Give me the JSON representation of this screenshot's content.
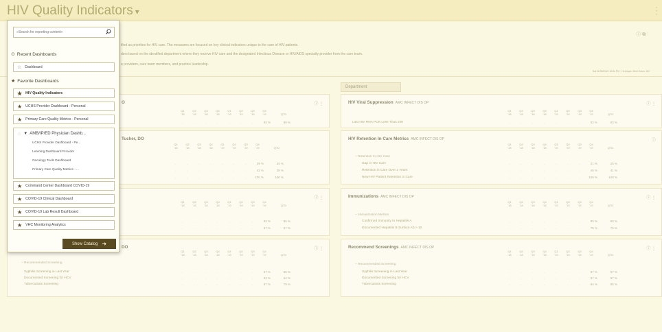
{
  "header": {
    "title": "HIV Quality Indicators",
    "caret": "▾",
    "menu_icon": "kebab-menu-icon"
  },
  "description": {
    "line1": "ified as priorities for HIV care. The measures are focused on key clinical indicators unique to the care of HIV patients.",
    "line2": "ders based on the identified department where they receive HIV care and the designated Infectious Disease or HIV/AIDS specialty provider from the care team.",
    "line3": "e providers, care team members, and practice leadership.",
    "timestamp": "Sat 11/30/2019 10:53 PM · Henrique, Bem Tozzo, DO",
    "icons": "ⓘ ⧉ ⋮"
  },
  "department_tab": "Department",
  "dropdown": {
    "search_placeholder": "»Search for reporting content«",
    "recent_header": "Recent Dashboards",
    "recent_items": [
      "Dashboard"
    ],
    "favorite_header": "Favorite Dashboards",
    "favorites_top": [
      "HIV Quality Indicators",
      "UCHS Provider Dashboard - Personal",
      "Primary Care Quality Metrics - Personal"
    ],
    "group": {
      "label": "AMB/IP/ED Physician Dashb...",
      "items": [
        "UCHS Provider Dashboard - Pe...",
        "Learning Dashboard Provider",
        "Oncology Tools Dashboard",
        "Primary Care Quality Metrics - ..."
      ]
    },
    "favorites_bottom": [
      "Command Center Dashboard COVID-19",
      "COVID-19 Clinical Dashboard",
      "COVID-19 Lab Result Dashboard",
      "VHC Monitoring Analytics"
    ],
    "show_catalog": "Show Catalog"
  },
  "left_cards": {
    "c1_title_frag": "O",
    "c2_title_frag": "Tucker, DO",
    "c4_title_frag": "DO",
    "c1_vals": [
      "93 %",
      "88 %"
    ],
    "c2_vals": [
      [
        "29 %",
        "26 %"
      ],
      [
        "42 %",
        "39 %"
      ],
      [
        "100 %",
        "100 %"
      ]
    ],
    "c3_vals": [
      [
        "93 %",
        "85 %"
      ],
      [
        "67 %",
        "67 %"
      ]
    ],
    "c4": {
      "group": "− Recommended Screening",
      "rows": [
        {
          "label": "Syphilis Screening in Last Year",
          "v1": "57 %",
          "v2": "65 %"
        },
        {
          "label": "Documented Screening for HCV",
          "v1": "93 %",
          "v2": "94 %"
        },
        {
          "label": "Tuberculosis Screening",
          "v1": "67 %",
          "v2": "79 %"
        }
      ]
    }
  },
  "quarter_cols": [
    "Q1 '18",
    "Q2 '18",
    "Q3 '18",
    "Q4 '18",
    "Q1 '19",
    "Q2 '19",
    "Q3 '19",
    "Q4 '19"
  ],
  "ytd": "QTD",
  "dept_cards": {
    "viral": {
      "title": "HIV Viral Suppression",
      "dept": "AMC INFECT DIS OP",
      "rows": [
        {
          "label": "Last HIV RNA PCR Less Than 200",
          "v1": "92 %",
          "v2": "93 %"
        }
      ]
    },
    "retention": {
      "title": "HIV Retention In Care Metrics",
      "dept": "AMC INFECT DIS OP",
      "group": "− Retention In HIV Care",
      "q4": "Q4 '19",
      "rows": [
        {
          "label": "Gap in HIV Care",
          "v1": "21 %",
          "v2": "25 %"
        },
        {
          "label": "Retention in Care Over 2 Years",
          "v1": "46 %",
          "v2": "41 %"
        },
        {
          "label": "New HIV Patient Retention in Care",
          "v1": "100 %",
          "v2": "100 %"
        }
      ]
    },
    "immun": {
      "title": "Immunizations",
      "dept": "AMC INFECT DIS OP",
      "group": "− Immunization Metrics",
      "rows": [
        {
          "label": "Confirmed Immunity to Hepatitis A",
          "v1": "80 %",
          "v2": "80 %"
        },
        {
          "label": "Documented Hepatitis B Surface Ab > 10",
          "v1": "75 %",
          "v2": "75 %"
        }
      ]
    },
    "screen": {
      "title": "Recommend Screenings",
      "dept": "AMC INFECT DIS OP",
      "group": "− Recommended Screening",
      "rows": [
        {
          "label": "Syphilis Screening in Last Year",
          "v1": "57 %",
          "v2": "57 %"
        },
        {
          "label": "Documented Screening for HCV",
          "v1": "97 %",
          "v2": "97 %"
        },
        {
          "label": "Tuberculosis Screening",
          "v1": "84 %",
          "v2": "85 %"
        }
      ]
    }
  }
}
